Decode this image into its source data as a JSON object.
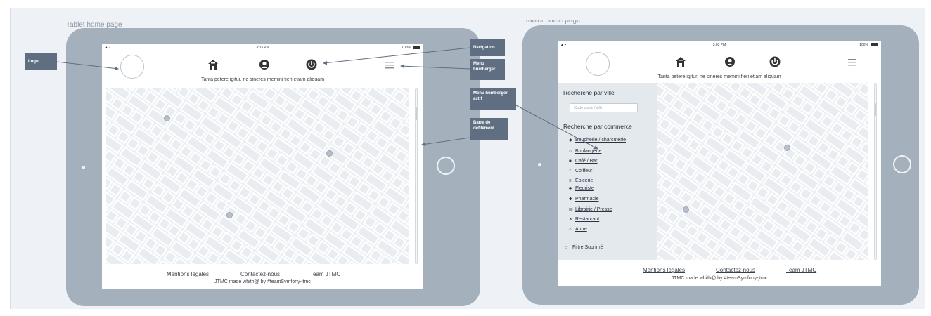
{
  "frames": [
    {
      "title": "Tablet home page"
    },
    {
      "title": "Tablet home page"
    }
  ],
  "status_bar": {
    "signal": "▲ •",
    "time": "3:03 PM",
    "battery": "100%"
  },
  "tagline": "Tanta petere igitur, ne sineres memini fieri etiam aliquam",
  "footer": {
    "links": [
      "Mentions légales",
      "Contactez-nous",
      "Team JTMC"
    ],
    "credit": "JTMC made whith@ by #teamSymfony-jtmc"
  },
  "nav_icons": [
    "home-icon",
    "user-icon",
    "power-icon"
  ],
  "annotations": {
    "logo": "Logo",
    "navigation": "Navigation",
    "menu_hamburger": "Menu humberger",
    "menu_hamburger_active": "Menu humberger actif",
    "scrollbar": "Barre de défilement"
  },
  "side_panel": {
    "city_heading": "Recherche par ville",
    "city_placeholder": "Code postal / ville",
    "commerce_heading": "Recherche par commerce",
    "categories": [
      {
        "icon": "meat-icon",
        "glyph": "◆",
        "label": "Boucherie / charcuterie"
      },
      {
        "icon": "bread-icon",
        "glyph": "∩",
        "label": "Boulangerie"
      },
      {
        "icon": "coffee-icon",
        "glyph": "■",
        "label": "Café / Bar"
      },
      {
        "icon": "scissors-icon",
        "glyph": "†",
        "label": "Coiffeur"
      },
      {
        "icon": "grocery-icon",
        "glyph": "≡",
        "label": "Epicerie"
      },
      {
        "icon": "flower-icon",
        "glyph": "♣",
        "label": "Fleuriste"
      },
      {
        "icon": "pharmacy-icon",
        "glyph": "✚",
        "label": "Pharmacie"
      },
      {
        "icon": "book-icon",
        "glyph": "▤",
        "label": "Librairie / Presse"
      },
      {
        "icon": "restaurant-icon",
        "glyph": "✕",
        "label": "Restaurant"
      },
      {
        "icon": "other-icon",
        "glyph": "⌂",
        "label": "Autre"
      }
    ],
    "reset_filter": {
      "icon": "trash-icon",
      "glyph": "⌂",
      "label": "Filtre Suprimé"
    }
  },
  "colors": {
    "tablet": "#a5b0bd",
    "annotation": "#5f6e80",
    "map_background": "#e9edf1",
    "side_panel": "#e4e9ee"
  }
}
